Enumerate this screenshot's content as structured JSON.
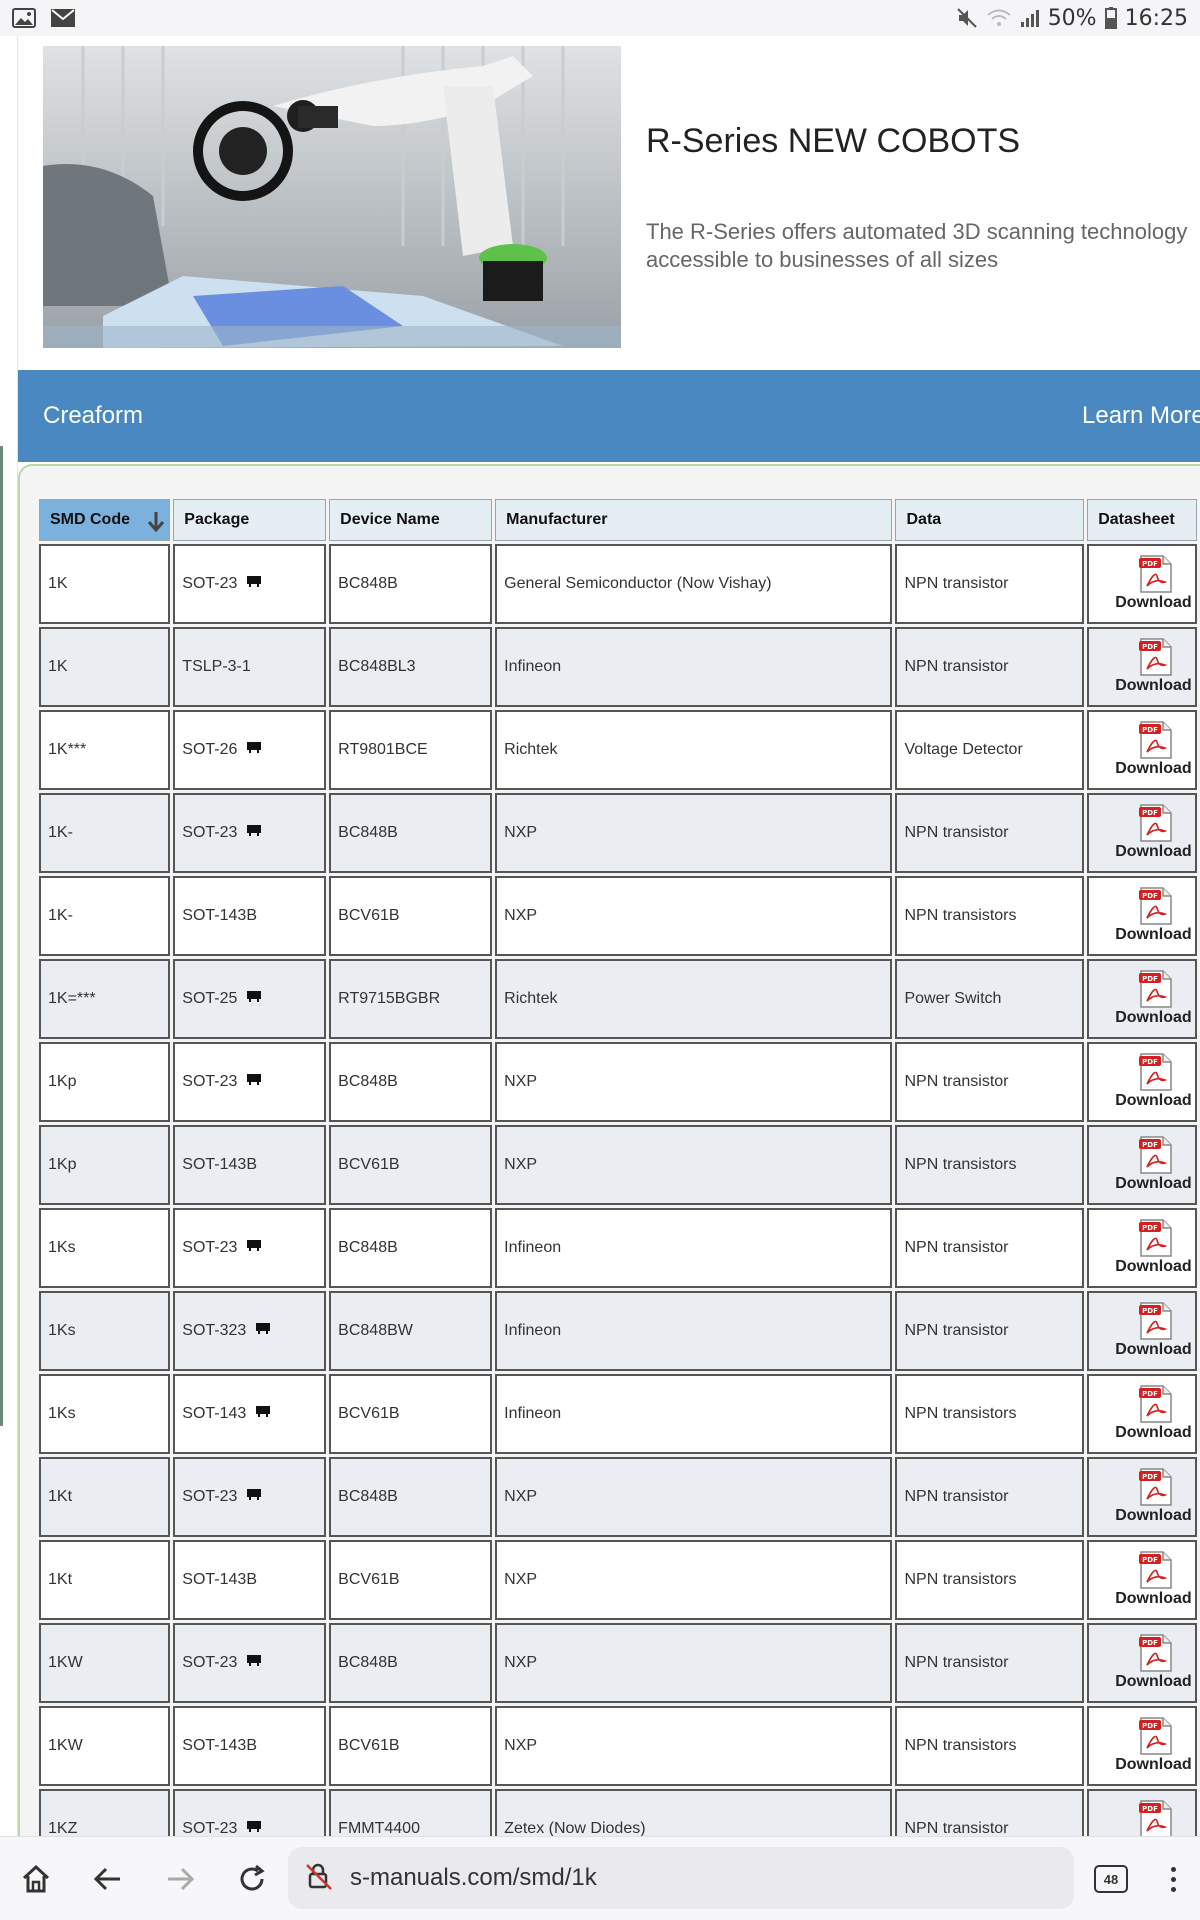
{
  "status_bar": {
    "battery_percent": "50%",
    "time": "16:25",
    "left_icons": [
      "gallery-icon",
      "mail-icon"
    ],
    "right_icons": [
      "mute-icon",
      "wifi-icon",
      "signal-icon",
      "battery-icon"
    ]
  },
  "ad": {
    "title": "R-Series NEW COBOTS",
    "description_line1": "The R-Series offers automated 3D scanning technology",
    "description_line2": "accessible to businesses of all sizes",
    "brand": "Creaform",
    "cta": "Learn More",
    "accent_color": "#4a88c2"
  },
  "table": {
    "columns": [
      "SMD Code",
      "Package",
      "Device Name",
      "Manufacturer",
      "Data",
      "Datasheet"
    ],
    "sorted_column": "SMD Code",
    "download_label": "Download",
    "rows": [
      {
        "code": "1K",
        "package": "SOT-23",
        "device": "BC848B",
        "manufacturer": "General Semiconductor (Now Vishay)",
        "data": "NPN transistor"
      },
      {
        "code": "1K",
        "package": "TSLP-3-1",
        "device": "BC848BL3",
        "manufacturer": "Infineon",
        "data": "NPN transistor"
      },
      {
        "code": "1K***",
        "package": "SOT-26",
        "device": "RT9801BCE",
        "manufacturer": "Richtek",
        "data": "Voltage Detector"
      },
      {
        "code": "1K-",
        "package": "SOT-23",
        "device": "BC848B",
        "manufacturer": "NXP",
        "data": "NPN transistor"
      },
      {
        "code": "1K-",
        "package": "SOT-143B",
        "device": "BCV61B",
        "manufacturer": "NXP",
        "data": "NPN transistors"
      },
      {
        "code": "1K=***",
        "package": "SOT-25",
        "device": "RT9715BGBR",
        "manufacturer": "Richtek",
        "data": "Power Switch"
      },
      {
        "code": "1Kp",
        "package": "SOT-23",
        "device": "BC848B",
        "manufacturer": "NXP",
        "data": "NPN transistor"
      },
      {
        "code": "1Kp",
        "package": "SOT-143B",
        "device": "BCV61B",
        "manufacturer": "NXP",
        "data": "NPN transistors"
      },
      {
        "code": "1Ks",
        "package": "SOT-23",
        "device": "BC848B",
        "manufacturer": "Infineon",
        "data": "NPN transistor"
      },
      {
        "code": "1Ks",
        "package": "SOT-323",
        "device": "BC848BW",
        "manufacturer": "Infineon",
        "data": "NPN transistor"
      },
      {
        "code": "1Ks",
        "package": "SOT-143",
        "device": "BCV61B",
        "manufacturer": "Infineon",
        "data": "NPN transistors"
      },
      {
        "code": "1Kt",
        "package": "SOT-23",
        "device": "BC848B",
        "manufacturer": "NXP",
        "data": "NPN transistor"
      },
      {
        "code": "1Kt",
        "package": "SOT-143B",
        "device": "BCV61B",
        "manufacturer": "NXP",
        "data": "NPN transistors"
      },
      {
        "code": "1KW",
        "package": "SOT-23",
        "device": "BC848B",
        "manufacturer": "NXP",
        "data": "NPN transistor"
      },
      {
        "code": "1KW",
        "package": "SOT-143B",
        "device": "BCV61B",
        "manufacturer": "NXP",
        "data": "NPN transistors"
      },
      {
        "code": "1KZ",
        "package": "SOT-23",
        "device": "FMMT4400",
        "manufacturer": "Zetex (Now Diodes)",
        "data": "NPN transistor"
      }
    ]
  },
  "browser": {
    "url": "s-manuals.com/smd/1k",
    "tab_count": "48",
    "icons": [
      "home-icon",
      "back-icon",
      "forward-icon",
      "reload-icon",
      "insecure-lock-icon",
      "menu-icon"
    ]
  }
}
